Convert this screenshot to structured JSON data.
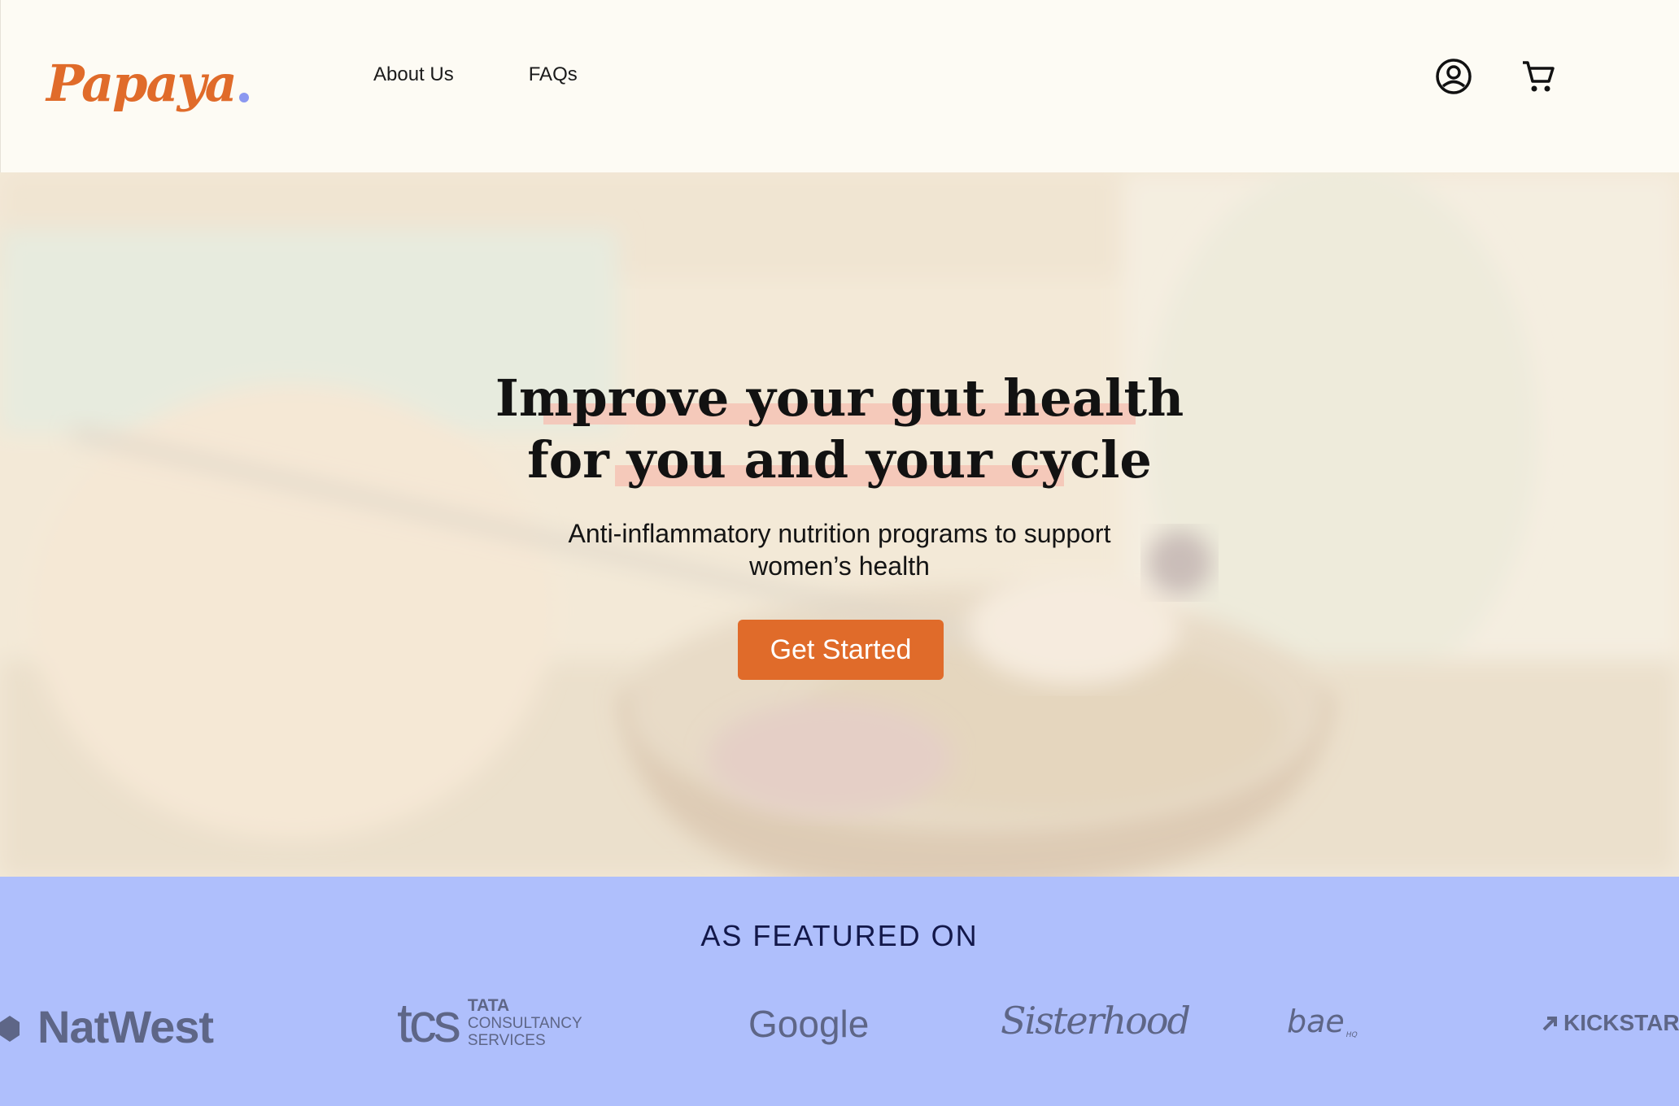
{
  "header": {
    "logo_text": "Papaya",
    "nav": [
      "About Us",
      "FAQs"
    ],
    "icons": [
      "account-icon",
      "cart-icon"
    ]
  },
  "hero": {
    "headline_line1": "Improve your gut health",
    "headline_line2": "for you and your cycle",
    "subtext_line1": "Anti-inflammatory nutrition programs to support",
    "subtext_line2": "women’s health",
    "cta_label": "Get Started"
  },
  "featured": {
    "title": "AS FEATURED ON",
    "logos": {
      "natwest": "NatWest",
      "tcs": "tcs",
      "tcs_sub1": "TATA",
      "tcs_sub2": "CONSULTANCY",
      "tcs_sub3": "SERVICES",
      "google": "Google",
      "sisterhood": "Sisterhood",
      "bae": "bae",
      "bae_hq": "HQ",
      "kickstarter": "KICKSTAR"
    }
  },
  "colors": {
    "brand_orange": "#e06b2a",
    "featured_bg": "#afbffc",
    "header_bg": "#fdfbf4",
    "highlight": "#f6beb0"
  }
}
